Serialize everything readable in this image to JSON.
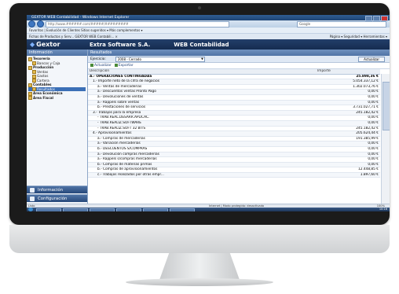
{
  "browser": {
    "window_title": "GEXTOR WEB Contabilidad - Windows Internet Explorer",
    "address": "http://www.######.com/#####/#########",
    "search_placeholder": "Google",
    "favorites": "Favoritos  |  Evolución de Clientes   Sitios sugeridos ▾   Más complementos ▾",
    "tabs": "Fichas de Productos y Serv...   GEXTOR WEB Contabili...  ×",
    "toolbar": "Página ▾  Seguridad ▾  Herramientas ▾"
  },
  "app": {
    "logo": "Gextor",
    "company": "Extra Software S.A.",
    "title": "WEB Contabilidad"
  },
  "sidebar": {
    "header": "Información",
    "tree": [
      {
        "label": "Tesorería",
        "level": 0,
        "selected": false
      },
      {
        "label": "Bancos y Caja",
        "level": 1,
        "selected": false
      },
      {
        "label": "Producción",
        "level": 0,
        "selected": false
      },
      {
        "label": "Ventas",
        "level": 1,
        "selected": false
      },
      {
        "label": "Gastos",
        "level": 1,
        "selected": false
      },
      {
        "label": "Cartera",
        "level": 1,
        "selected": false
      },
      {
        "label": "Contables",
        "level": 0,
        "selected": false
      },
      {
        "label": "Resultados",
        "level": 1,
        "selected": true
      },
      {
        "label": "Área Económica",
        "level": 0,
        "selected": false
      },
      {
        "label": "Área Fiscal",
        "level": 0,
        "selected": false
      }
    ],
    "btn_info": "Información",
    "btn_config": "Configuración"
  },
  "main": {
    "header": "Resultados",
    "filter_label": "Ejercicio:",
    "filter_value": "2008 - Cerrado",
    "refresh_button": "Actualizar",
    "action_refresh": "Actualizar",
    "action_export": "Exportar",
    "col_desc": "Descripción",
    "col_amount": "Importe",
    "rows": [
      {
        "desc": "A.- OPERACIONES CONTINUADAS",
        "amount": "25.898,36 €",
        "level": 0
      },
      {
        "desc": "1.- Importe neto de la cifra de negocios",
        "amount": "5.054.337,12 €",
        "level": 1
      },
      {
        "desc": "a.- Ventas de mercaderías",
        "amount": "1.302.073,76 €",
        "level": 2
      },
      {
        "desc": "a.- Descuentos ventas Pronto Pago",
        "amount": "0,00 €",
        "level": 2
      },
      {
        "desc": "a.- Devoluciones de ventas",
        "amount": "0,00 €",
        "level": 2
      },
      {
        "desc": "a.- Rappels sobre ventas",
        "amount": "0,00 €",
        "level": 2
      },
      {
        "desc": "b.- Prestaciones de servicios",
        "amount": "3.731.027,71 €",
        "level": 2
      },
      {
        "desc": "3.- Trabajos para la empresa",
        "amount": "245.182,42 €",
        "level": 1
      },
      {
        "desc": "- TRAB.REAL.DESARR.APLICAC.",
        "amount": "0,00 €",
        "level": 2
      },
      {
        "desc": "- TRAB.REALIZ.SOFTWARE",
        "amount": "0,00 €",
        "level": 2
      },
      {
        "desc": "- TRAB.REALIZ.SOFT 32 BITS",
        "amount": "245.182,42 €",
        "level": 2
      },
      {
        "desc": "4.- Aprovisionamientos",
        "amount": "205.624,44 €",
        "level": 1
      },
      {
        "desc": "a.- Compras de mercaderías",
        "amount": "191.385,99 €",
        "level": 2
      },
      {
        "desc": "a.- Variación mercaderías",
        "amount": "0,00 €",
        "level": 2
      },
      {
        "desc": "b.- DESCUENTOS S/COMPRAS",
        "amount": "0,00 €",
        "level": 2
      },
      {
        "desc": "a.- Devolución compras mercaderías",
        "amount": "0,00 €",
        "level": 2
      },
      {
        "desc": "a.- Rappels s/compras mercaderías",
        "amount": "0,00 €",
        "level": 2
      },
      {
        "desc": "b.- Compras de materias primas",
        "amount": "0,00 €",
        "level": 2
      },
      {
        "desc": "b.- Compras de aprovisionamientos",
        "amount": "12.448,85 €",
        "level": 2
      },
      {
        "desc": "c.- Trabajos realizados por otras empr...",
        "amount": "1.897,60 €",
        "level": 2
      }
    ]
  },
  "status": {
    "left": "Listo",
    "middle": "Internet | Modo protegido: desactivado",
    "zoom": "100%",
    "clock": "10:16"
  }
}
